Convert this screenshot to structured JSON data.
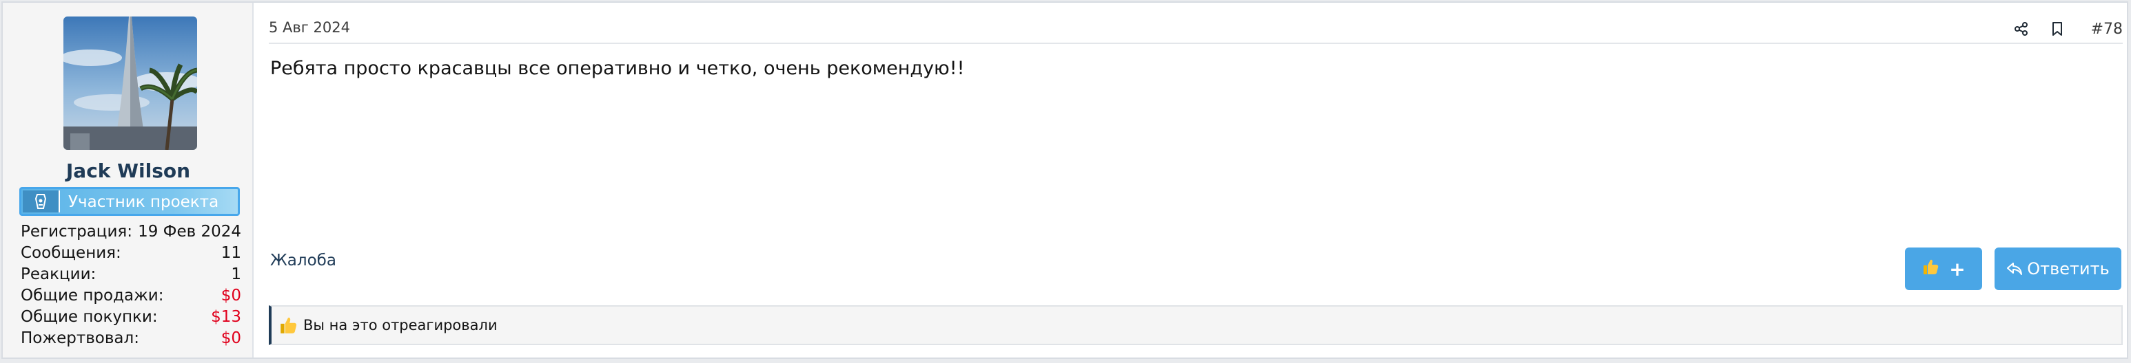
{
  "user": {
    "name": "Jack Wilson",
    "role": "Участник проекта",
    "avatar_alt": "avatar",
    "stats": [
      {
        "label": "Регистрация:",
        "value": "19 Фев 2024",
        "color": "default"
      },
      {
        "label": "Сообщения:",
        "value": "11",
        "color": "default"
      },
      {
        "label": "Реакции:",
        "value": "1",
        "color": "default"
      },
      {
        "label": "Общие продажи:",
        "value": "$0",
        "color": "red"
      },
      {
        "label": "Общие покупки:",
        "value": "$13",
        "color": "red"
      },
      {
        "label": "Пожертвовал:",
        "value": "$0",
        "color": "red"
      }
    ]
  },
  "post": {
    "date": "5 Авг 2024",
    "number": "#78",
    "body": "Ребята просто красавцы все оперативно и четко, очень рекомендую!!",
    "report_label": "Жалоба",
    "like_label": "+",
    "reply_label": "Ответить",
    "reactions_text": "Вы на это отреагировали"
  },
  "icons": {
    "share": "share-icon",
    "bookmark": "bookmark-icon",
    "thumbs_up": "thumbs-up-icon",
    "reply": "reply-icon",
    "role": "role-badge-icon"
  },
  "colors": {
    "accent": "#4aa6e6",
    "name": "#1f3b57",
    "money": "#e0001c"
  }
}
